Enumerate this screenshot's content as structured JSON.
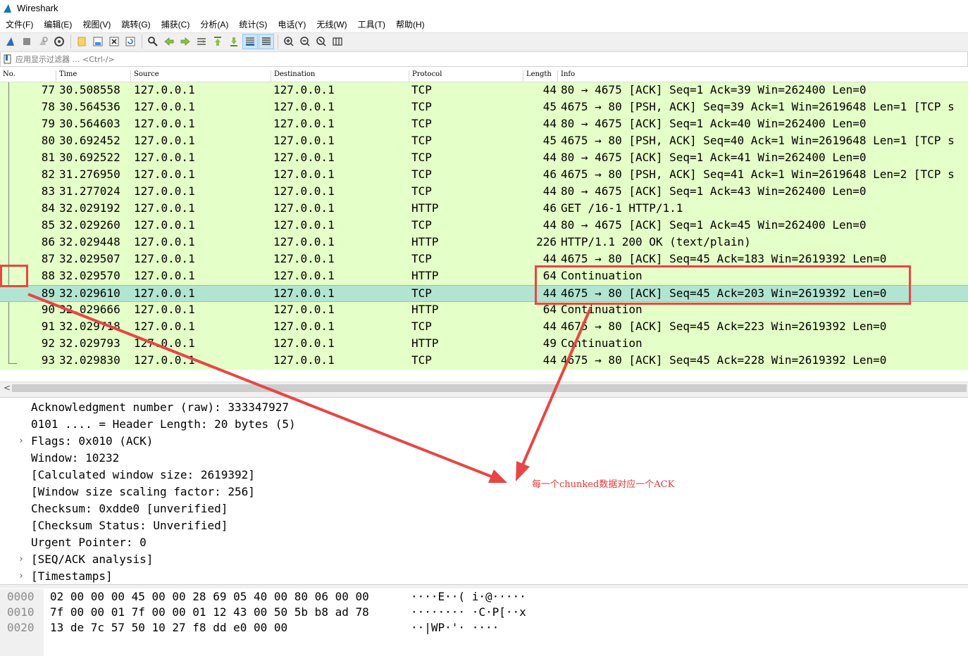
{
  "app": {
    "title": "Wireshark"
  },
  "menu": [
    "文件(F)",
    "编辑(E)",
    "视图(V)",
    "跳转(G)",
    "捕获(C)",
    "分析(A)",
    "统计(S)",
    "电话(Y)",
    "无线(W)",
    "工具(T)",
    "帮助(H)"
  ],
  "toolbar": {
    "icons": [
      "shark-fin-icon",
      "stop-icon",
      "restart-icon",
      "capture-options-icon",
      "open-file-icon",
      "save-file-icon",
      "close-file-icon",
      "reload-icon",
      "find-packet-icon",
      "go-back-icon",
      "go-forward-icon",
      "go-to-packet-icon",
      "first-packet-icon",
      "last-packet-icon",
      "autoscroll-icon",
      "colorize-icon",
      "zoom-in-icon",
      "zoom-out-icon",
      "normal-size-icon",
      "resize-columns-icon"
    ]
  },
  "filter": {
    "placeholder": "应用显示过滤器 … <Ctrl-/>"
  },
  "columns": {
    "no": "No.",
    "time": "Time",
    "source": "Source",
    "destination": "Destination",
    "protocol": "Protocol",
    "length": "Length",
    "info": "Info"
  },
  "packets": [
    {
      "no": "77",
      "time": "30.508558",
      "src": "127.0.0.1",
      "dst": "127.0.0.1",
      "proto": "TCP",
      "len": "44",
      "info": "80 → 4675 [ACK] Seq=1 Ack=39 Win=262400 Len=0"
    },
    {
      "no": "78",
      "time": "30.564536",
      "src": "127.0.0.1",
      "dst": "127.0.0.1",
      "proto": "TCP",
      "len": "45",
      "info": "4675 → 80 [PSH, ACK] Seq=39 Ack=1 Win=2619648 Len=1 [TCP s"
    },
    {
      "no": "79",
      "time": "30.564603",
      "src": "127.0.0.1",
      "dst": "127.0.0.1",
      "proto": "TCP",
      "len": "44",
      "info": "80 → 4675 [ACK] Seq=1 Ack=40 Win=262400 Len=0"
    },
    {
      "no": "80",
      "time": "30.692452",
      "src": "127.0.0.1",
      "dst": "127.0.0.1",
      "proto": "TCP",
      "len": "45",
      "info": "4675 → 80 [PSH, ACK] Seq=40 Ack=1 Win=2619648 Len=1 [TCP s"
    },
    {
      "no": "81",
      "time": "30.692522",
      "src": "127.0.0.1",
      "dst": "127.0.0.1",
      "proto": "TCP",
      "len": "44",
      "info": "80 → 4675 [ACK] Seq=1 Ack=41 Win=262400 Len=0"
    },
    {
      "no": "82",
      "time": "31.276950",
      "src": "127.0.0.1",
      "dst": "127.0.0.1",
      "proto": "TCP",
      "len": "46",
      "info": "4675 → 80 [PSH, ACK] Seq=41 Ack=1 Win=2619648 Len=2 [TCP s"
    },
    {
      "no": "83",
      "time": "31.277024",
      "src": "127.0.0.1",
      "dst": "127.0.0.1",
      "proto": "TCP",
      "len": "44",
      "info": "80 → 4675 [ACK] Seq=1 Ack=43 Win=262400 Len=0"
    },
    {
      "no": "84",
      "time": "32.029192",
      "src": "127.0.0.1",
      "dst": "127.0.0.1",
      "proto": "HTTP",
      "len": "46",
      "info": "GET /16-1 HTTP/1.1"
    },
    {
      "no": "85",
      "time": "32.029260",
      "src": "127.0.0.1",
      "dst": "127.0.0.1",
      "proto": "TCP",
      "len": "44",
      "info": "80 → 4675 [ACK] Seq=1 Ack=45 Win=262400 Len=0"
    },
    {
      "no": "86",
      "time": "32.029448",
      "src": "127.0.0.1",
      "dst": "127.0.0.1",
      "proto": "HTTP",
      "len": "226",
      "info": "HTTP/1.1 200 OK  (text/plain)"
    },
    {
      "no": "87",
      "time": "32.029507",
      "src": "127.0.0.1",
      "dst": "127.0.0.1",
      "proto": "TCP",
      "len": "44",
      "info": "4675 → 80 [ACK] Seq=45 Ack=183 Win=2619392 Len=0"
    },
    {
      "no": "88",
      "time": "32.029570",
      "src": "127.0.0.1",
      "dst": "127.0.0.1",
      "proto": "HTTP",
      "len": "64",
      "info": "Continuation"
    },
    {
      "no": "89",
      "time": "32.029610",
      "src": "127.0.0.1",
      "dst": "127.0.0.1",
      "proto": "TCP",
      "len": "44",
      "info": "4675 → 80 [ACK] Seq=45 Ack=203 Win=2619392 Len=0"
    },
    {
      "no": "90",
      "time": "32.029666",
      "src": "127.0.0.1",
      "dst": "127.0.0.1",
      "proto": "HTTP",
      "len": "64",
      "info": "Continuation"
    },
    {
      "no": "91",
      "time": "32.029718",
      "src": "127.0.0.1",
      "dst": "127.0.0.1",
      "proto": "TCP",
      "len": "44",
      "info": "4675 → 80 [ACK] Seq=45 Ack=223 Win=2619392 Len=0"
    },
    {
      "no": "92",
      "time": "32.029793",
      "src": "127.0.0.1",
      "dst": "127.0.0.1",
      "proto": "HTTP",
      "len": "49",
      "info": "Continuation"
    },
    {
      "no": "93",
      "time": "32.029830",
      "src": "127.0.0.1",
      "dst": "127.0.0.1",
      "proto": "TCP",
      "len": "44",
      "info": "4675 → 80 [ACK] Seq=45 Ack=228 Win=2619392 Len=0"
    }
  ],
  "selected_packet": "89",
  "details": [
    {
      "text": "Acknowledgment number (raw): 333347927",
      "expandable": false
    },
    {
      "text": "0101 .... = Header Length: 20 bytes (5)",
      "expandable": false
    },
    {
      "text": "Flags: 0x010 (ACK)",
      "expandable": true
    },
    {
      "text": "Window: 10232",
      "expandable": false
    },
    {
      "text": "[Calculated window size: 2619392]",
      "expandable": false
    },
    {
      "text": "[Window size scaling factor: 256]",
      "expandable": false
    },
    {
      "text": "Checksum: 0xdde0 [unverified]",
      "expandable": false
    },
    {
      "text": "[Checksum Status: Unverified]",
      "expandable": false
    },
    {
      "text": "Urgent Pointer: 0",
      "expandable": false
    },
    {
      "text": "[SEQ/ACK analysis]",
      "expandable": true
    },
    {
      "text": "[Timestamps]",
      "expandable": true
    }
  ],
  "bytes": [
    {
      "offset": "0000",
      "hex": "02 00 00 00 45 00 00 28  69 05 40 00 80 06 00 00",
      "ascii": "····E··( i·@·····"
    },
    {
      "offset": "0010",
      "hex": "7f 00 00 01 7f 00 00 01  12 43 00 50 5b b8 ad 78",
      "ascii": "········ ·C·P[··x"
    },
    {
      "offset": "0020",
      "hex": "13 de 7c 57 50 10 27 f8  dd e0 00 00",
      "ascii": "··|WP·'· ····"
    }
  ],
  "annotation": {
    "text": "每一个chunked数据对应一个ACK",
    "color": "#e83434"
  },
  "colors": {
    "tcp_row_bg": "#e4ffc7",
    "selected_row_bg": "#b1e5d1",
    "annotation_red": "#e84545"
  }
}
